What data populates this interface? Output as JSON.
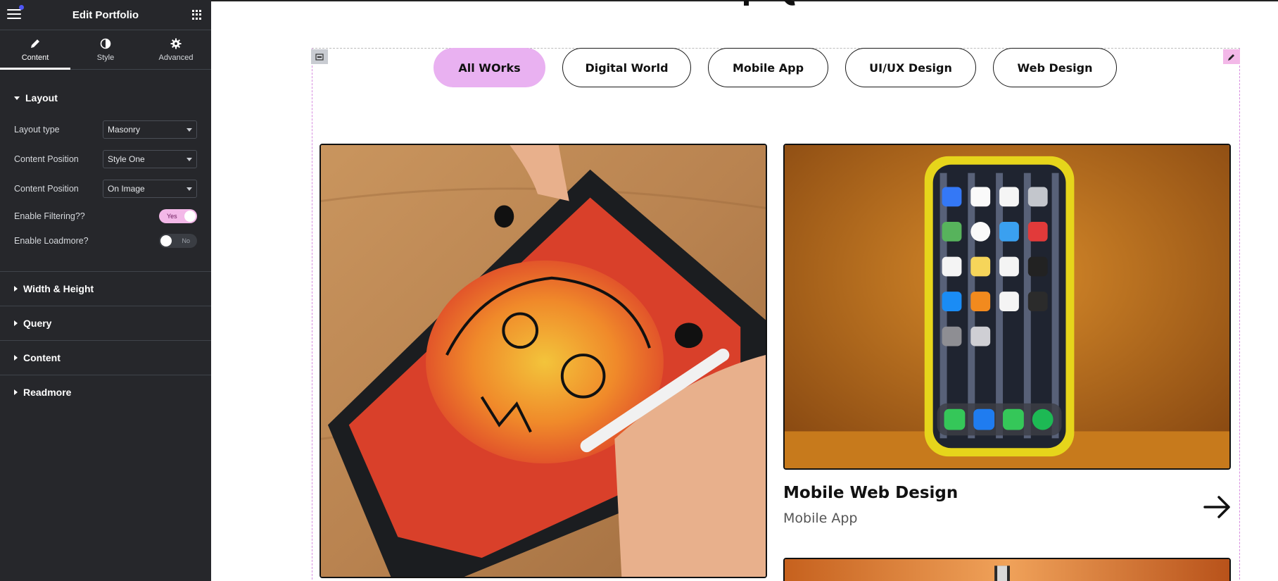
{
  "sidebar": {
    "title": "Edit Portfolio",
    "tabs": [
      {
        "label": "Content",
        "icon": "pencil-icon"
      },
      {
        "label": "Style",
        "icon": "contrast-icon"
      },
      {
        "label": "Advanced",
        "icon": "gear-icon"
      }
    ],
    "layout_section": {
      "title": "Layout",
      "controls": {
        "layout_type": {
          "label": "Layout type",
          "value": "Masonry"
        },
        "content_position_1": {
          "label": "Content Position",
          "value": "Style One"
        },
        "content_position_2": {
          "label": "Content Position",
          "value": "On Image"
        },
        "enable_filtering": {
          "label": "Enable Filtering??",
          "value": "Yes"
        },
        "enable_loadmore": {
          "label": "Enable Loadmore?",
          "value": "No"
        }
      }
    },
    "sections": [
      "Width & Height",
      "Query",
      "Content",
      "Readmore"
    ]
  },
  "canvas": {
    "filters": [
      "All WOrks",
      "Digital World",
      "Mobile App",
      "UI/UX Design",
      "Web Design"
    ],
    "active_filter": "All WOrks",
    "cards": [
      {
        "title": "",
        "category": "",
        "image": "tablet-drawing-image"
      },
      {
        "title": "Mobile Web Design",
        "category": "Mobile App",
        "image": "smartphone-image"
      },
      {
        "title": "",
        "category": "",
        "image": "orange-product-image"
      }
    ]
  },
  "colors": {
    "sidebar_bg": "#26272b",
    "accent_pink": "#e9b1f1",
    "notification_dot": "#4f56f5"
  }
}
